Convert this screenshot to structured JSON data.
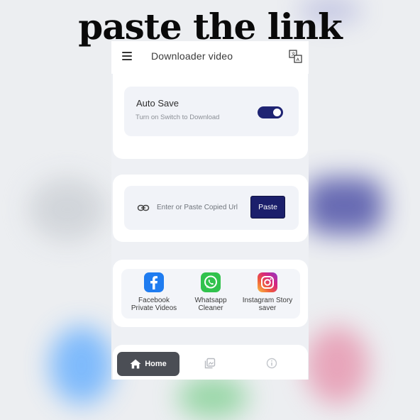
{
  "overlay": {
    "caption": "paste the link"
  },
  "appbar": {
    "title": "Downloader video",
    "menu_icon": "hamburger-menu-icon",
    "translate_icon": "translate-icon"
  },
  "autosave": {
    "title": "Auto Save",
    "subtitle": "Turn on Switch to Download",
    "enabled": true
  },
  "paste": {
    "placeholder": "Enter or Paste Copied Url",
    "button_label": "Paste",
    "icon": "link-icon"
  },
  "apps": [
    {
      "line1": "Facebook",
      "line2": "Private Videos",
      "icon": "facebook-icon"
    },
    {
      "line1": "Whatsapp",
      "line2": "Cleaner",
      "icon": "whatsapp-icon"
    },
    {
      "line1": "Instagram Story",
      "line2": "saver",
      "icon": "instagram-icon"
    }
  ],
  "bottom_nav": {
    "home_label": "Home",
    "items": [
      "home-icon",
      "gallery-icon",
      "info-icon"
    ]
  },
  "colors": {
    "accent": "#1b1f6b",
    "toggle": "#1f2473",
    "home_bg": "#4b4e55"
  }
}
